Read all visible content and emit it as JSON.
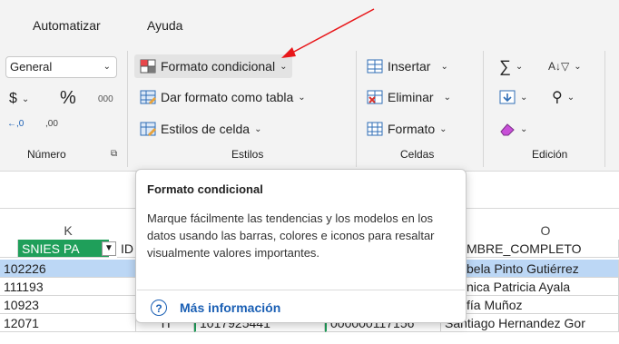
{
  "menu": {
    "items": [
      "Automatizar",
      "Ayuda"
    ]
  },
  "ribbon": {
    "numero": {
      "format_value": "General",
      "currency": "$",
      "percent": "%",
      "thousands": "000",
      "dec_inc": ",0",
      "dec_dec": ",00",
      "label": "Número"
    },
    "estilos": {
      "conditional_format": "Formato condicional",
      "format_table": "Dar formato como tabla",
      "cell_styles": "Estilos de celda",
      "label": "Estilos"
    },
    "celdas": {
      "insert": "Insertar",
      "delete": "Eliminar",
      "format": "Formato",
      "label": "Celdas"
    },
    "edicion": {
      "label": "Edición"
    }
  },
  "sheet": {
    "col_k": "K",
    "col_o": "O",
    "hdr_snies": "SNIES PA",
    "hdr_id": "ID",
    "hdr_nombre": "MBRE_COMPLETO",
    "rows": [
      {
        "k": "102226",
        "name": "bela Pinto Gutiérrez"
      },
      {
        "k": "111193",
        "name": "nica Patricia Ayala"
      },
      {
        "k": "10923",
        "name": "fía Muñoz"
      },
      {
        "k": "12071",
        "id": "TI",
        "doc": "1017925441",
        "code": "000000117156",
        "name": "Santiago Hernandez Gor"
      }
    ]
  },
  "tooltip": {
    "title": "Formato condicional",
    "description": "Marque fácilmente las tendencias y los modelos en los datos usando las barras, colores e iconos para resaltar visualmente valores importantes.",
    "help_icon": "?",
    "link": "Más información"
  },
  "colors": {
    "accent_link": "#1a5fb4",
    "arrow": "#e8171a",
    "header_green": "#1f9f5a",
    "selected_row": "#bcd7f5"
  }
}
